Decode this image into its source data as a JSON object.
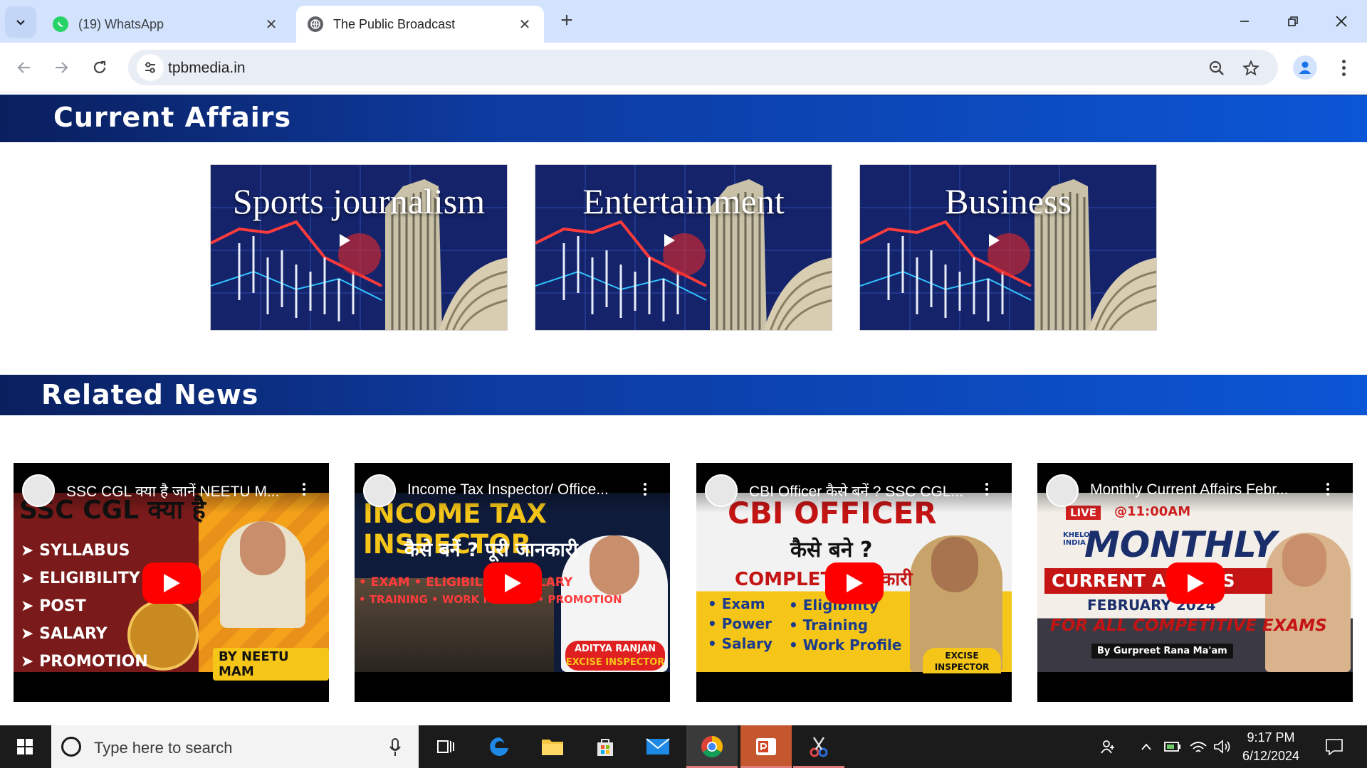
{
  "browser": {
    "tabs": [
      {
        "title": "(19) WhatsApp",
        "active": false
      },
      {
        "title": "The Public Broadcast",
        "active": true
      }
    ],
    "url": "tpbmedia.in"
  },
  "page": {
    "current_affairs": {
      "heading": "Current Affairs",
      "categories": [
        "Sports journalism",
        "Entertainment",
        "Business"
      ]
    },
    "related_news": {
      "heading": "Related News",
      "videos": [
        {
          "title": "SSC CGL क्या है जानें NEETU M...",
          "headline": "SSC CGL क्या है",
          "bullets": [
            "SYLLABUS",
            "ELIGIBILITY",
            "POST",
            "SALARY",
            "PROMOTION"
          ],
          "badge": "BY NEETU MAM"
        },
        {
          "title": "Income Tax Inspector/ Office...",
          "headline": "INCOME TAX INSPECTOR",
          "subline": "कैसे बनें ? पूरी जानकारी",
          "tags1": "• EXAM  • ELIGIBILITY  •  SALARY",
          "tags2": "• TRAINING  • WORK PROFILE  • PROMOTION",
          "badge1": "ADITYA RANJAN",
          "badge2": "EXCISE INSPECTOR"
        },
        {
          "title": "CBI Officer कैसे बनें ? SSC CGL...",
          "headline": "CBI OFFICER",
          "subline": "कैसे बने ?",
          "subline2": "COMPLETE जानकारी",
          "col1": [
            "• Exam",
            "• Power",
            "• Salary"
          ],
          "col2": [
            "• Eligibility",
            "• Training",
            "• Work Profile"
          ],
          "badge1": "EXCISE",
          "badge2": "INSPECTOR"
        },
        {
          "title": "Monthly Current Affairs Febr...",
          "live": "LIVE",
          "time": "@11:00AM",
          "brand1": "KHELO",
          "brand2": "INDIA",
          "headline": "MONTHLY",
          "banner": "CURRENT AFFAIRS",
          "month": "FEBRUARY 2024",
          "subline": "FOR ALL COMPETITIVE EXAMS",
          "badge": "By Gurpreet Rana Ma'am"
        }
      ]
    }
  },
  "taskbar": {
    "search_placeholder": "Type here to search",
    "time": "9:17 PM",
    "date": "6/12/2024"
  },
  "colors": {
    "banner_dark": "#0a1f5e",
    "banner_light": "#0b56d6",
    "tabstrip": "#d3e3fd",
    "youtube_red": "#ff0000"
  }
}
